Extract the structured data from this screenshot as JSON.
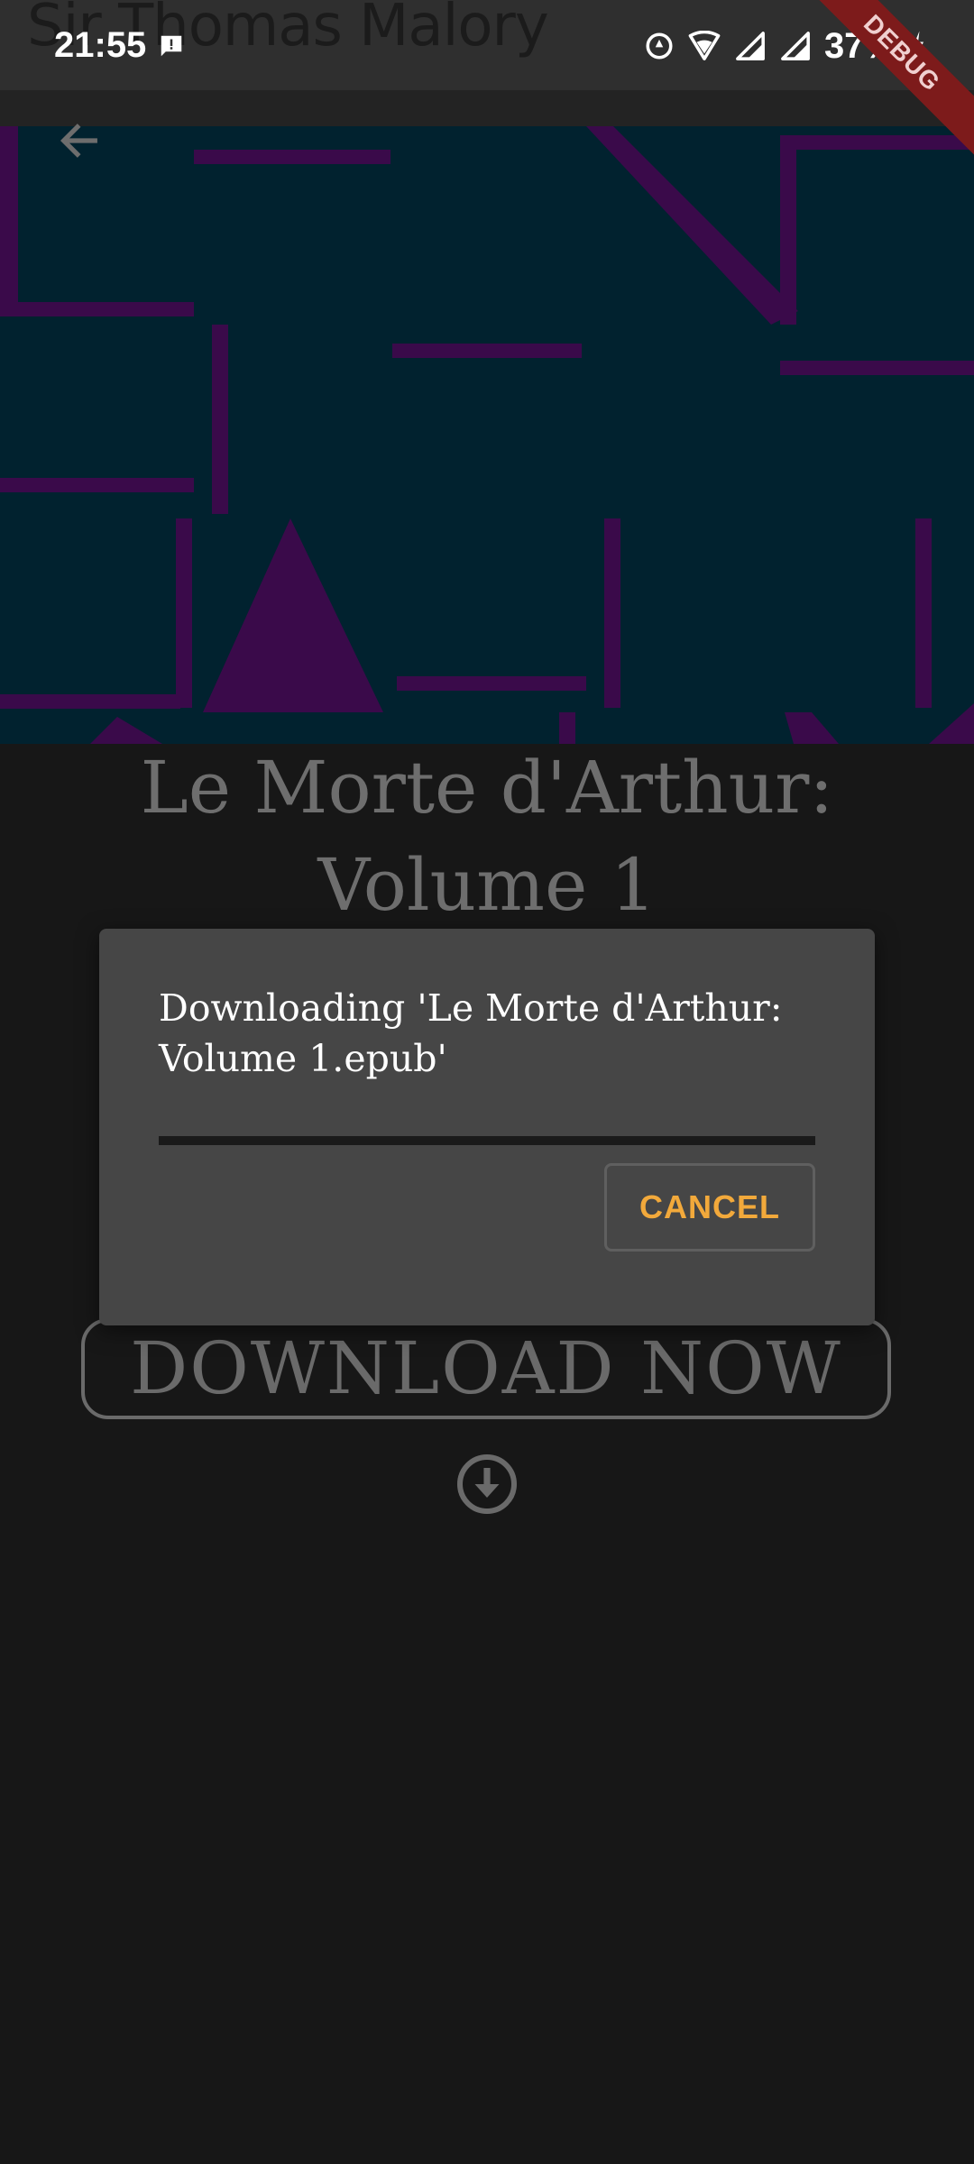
{
  "status_bar": {
    "time": "21:55",
    "battery": "37%",
    "background_author": "Sir Thomas Malory",
    "debug_banner": "DEBUG",
    "icons": [
      "message-icon",
      "data-saver-icon",
      "wifi-icon",
      "signal-icon",
      "signal-icon",
      "battery-charging-icon"
    ]
  },
  "app_bar": {
    "back_icon": "arrow-back-icon"
  },
  "book": {
    "title": "Le Morte d'Arthur: Volume 1",
    "download_label": "DOWNLOAD NOW",
    "download_icon": "download-circle-icon"
  },
  "dialog": {
    "message": "Downloading 'Le Morte d'Arthur: Volume 1.epub'",
    "progress": 0,
    "cancel_label": "CANCEL"
  },
  "colors": {
    "accent": "#f2a93b",
    "cover_background": "#01222f",
    "cover_pattern": "#3a0a4a",
    "page_background": "#171717",
    "dialog_background": "#464646"
  }
}
